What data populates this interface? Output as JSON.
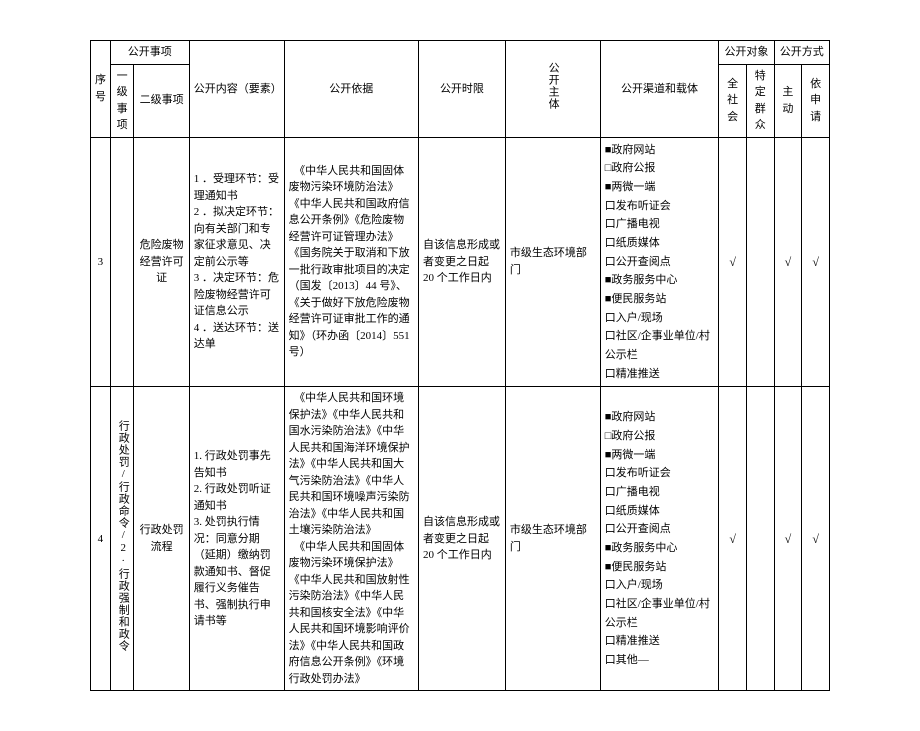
{
  "headers": {
    "seq": "序号",
    "open_item": "公开事项",
    "level1": "一级事项",
    "level2": "二级事项",
    "content": "公开内容（要素）",
    "basis": "公开依据",
    "timelimit": "公开时限",
    "subject": "公开主体",
    "channel": "公开渠道和载体",
    "target": "公开对象",
    "method": "公开方式",
    "target_all": "全社会",
    "target_spec": "特定群众",
    "method_active": "主动",
    "method_apply": "依申请"
  },
  "rows": [
    {
      "seq": "3",
      "level1": "",
      "level2": "危险废物经营许可证",
      "content": "1 ．受理环节：受理通知书\n2 ．拟决定环节：向有关部门和专家征求意见、决定前公示等\n3 ．决定环节：危险废物经营许可证信息公示\n4 ．送达环节：送达单",
      "basis": "　《中华人民共和国固体废物污染环境防治法》《中华人民共和国政府信息公开条例》《危险废物经营许可证管理办法》《国务院关于取消和下放一批行政审批项目的决定（国发〔2013〕44 号》、《关于做好下放危险废物经营许可证审批工作的通知》（环办函〔2014〕551号）",
      "timelimit": "自该信息形成或者变更之日起 20 个工作日内",
      "subject": "市级生态环境部门",
      "channel": "■政府网站\n□政府公报\n■两微一端\n口发布听证会\n口广播电视\n口纸质媒体\n口公开查阅点\n■政务服务中心\n■便民服务站\n口入户/现场\n口社区/企事业单位/村公示栏\n口精准推送",
      "all": "√",
      "spec": "",
      "active": "√",
      "apply": "√"
    },
    {
      "seq": "4",
      "level1": "行政处罚/行政命令/2·行政强制和政令",
      "level2": "行政处罚流程",
      "content": "1. 行政处罚事先告知书\n2. 行政处罚听证通知书\n3. 处罚执行情况：同意分期（延期）缴纳罚款通知书、督促履行义务催告书、强制执行申请书等",
      "basis": "　《中华人民共和国环境保护法》《中华人民共和国水污染防治法》《中华人民共和国海洋环境保护法》《中华人民共和国大气污染防治法》《中华人民共和国环境噪声污染防治法》《中华人民共和国土壤污染防治法》\n　《中华人民共和国固体废物污染环境保护法》《中华人民共和国放射性污染防治法》《中华人民共和国核安全法》《中华人民共和国环境影响评价法》《中华人民共和国政府信息公开条例》《环境行政处罚办法》",
      "timelimit": "自该信息形成或者变更之日起 20 个工作日内",
      "subject": "市级生态环境部门",
      "channel": "■政府网站\n□政府公报\n■两微一端\n口发布听证会\n口广播电视\n口纸质媒体\n口公开查阅点\n■政务服务中心\n■便民服务站\n口入户/现场\n口社区/企事业单位/村公示栏\n口精准推送\n口其他—",
      "all": "√",
      "spec": "",
      "active": "√",
      "apply": "√"
    }
  ]
}
